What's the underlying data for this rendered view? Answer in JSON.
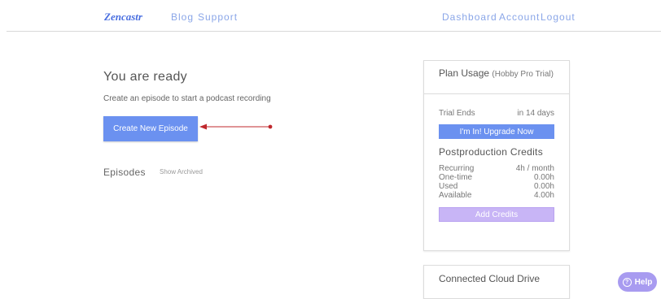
{
  "nav": {
    "logo": "Zencastr",
    "left_links": [
      "Blog",
      "Support"
    ],
    "right_links": [
      "Dashboard",
      "Account",
      "Logout"
    ],
    "link_color": "#8aa6e8"
  },
  "main": {
    "title": "You are ready",
    "subtitle": "Create an episode to start a podcast recording",
    "create_button": "Create New Episode",
    "episodes_label": "Episodes",
    "show_archived": "Show Archived",
    "annotation_arrow_color": "#c0282d"
  },
  "plan": {
    "title": "Plan Usage",
    "plan_name": "(Hobby Pro Trial)",
    "trial_label": "Trial Ends",
    "trial_value": "in 14 days",
    "upgrade_button": "I'm In! Upgrade Now",
    "credits_title": "Postproduction Credits",
    "credits": [
      {
        "label": "Recurring",
        "value": "4h / month"
      },
      {
        "label": "One-time",
        "value": "0.00h"
      },
      {
        "label": "Used",
        "value": "0.00h"
      },
      {
        "label": "Available",
        "value": "4.00h"
      }
    ],
    "add_credits_button": "Add Credits"
  },
  "cloud": {
    "title": "Connected Cloud Drive"
  },
  "help": {
    "label": "Help",
    "icon": "question-circle-icon"
  },
  "colors": {
    "primary": "#6b91f0",
    "secondary": "#c8b5f6",
    "help": "#a89bf0"
  }
}
